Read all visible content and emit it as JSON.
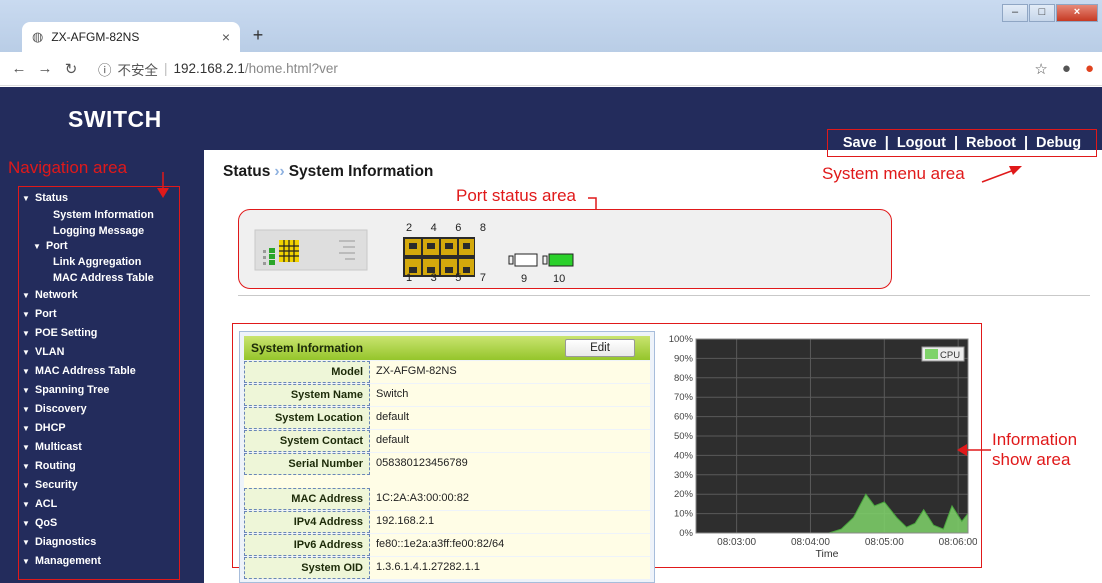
{
  "browser": {
    "tab_title": "ZX-AFGM-82NS",
    "new_tab": "+",
    "url_security": "不安全",
    "url_host": "192.168.2.1",
    "url_path": "/home.html?ver"
  },
  "header": {
    "logo": "SWITCH",
    "menu": [
      "Save",
      "Logout",
      "Reboot",
      "Debug"
    ],
    "menu_sep": "|"
  },
  "sidebar": {
    "items": [
      {
        "label": "Status",
        "expanded": true
      },
      {
        "label": "System Information",
        "level": 2,
        "active": true
      },
      {
        "label": "Logging Message",
        "level": 2
      },
      {
        "label": "Port",
        "level": 2,
        "expanded": true
      },
      {
        "label": "Link Aggregation",
        "level": 2
      },
      {
        "label": "MAC Address Table",
        "level": 2
      },
      {
        "label": "Network"
      },
      {
        "label": "Port"
      },
      {
        "label": "POE Setting"
      },
      {
        "label": "VLAN"
      },
      {
        "label": "MAC Address Table"
      },
      {
        "label": "Spanning Tree"
      },
      {
        "label": "Discovery"
      },
      {
        "label": "DHCP"
      },
      {
        "label": "Multicast"
      },
      {
        "label": "Routing"
      },
      {
        "label": "Security"
      },
      {
        "label": "ACL"
      },
      {
        "label": "QoS"
      },
      {
        "label": "Diagnostics"
      },
      {
        "label": "Management"
      }
    ]
  },
  "breadcrumb": {
    "parent": "Status",
    "sep": "››",
    "current": "System Information"
  },
  "annotations": {
    "navigation": "Navigation area",
    "port_status": "Port status area",
    "system_menu": "System menu area",
    "info_show": "Information show area"
  },
  "ports": {
    "top_numbers": [
      "2",
      "4",
      "6",
      "8"
    ],
    "bottom_numbers": [
      "1",
      "3",
      "5",
      "7"
    ],
    "sfp": [
      "9",
      "10"
    ],
    "sfp_active": [
      false,
      true
    ]
  },
  "sysinfo": {
    "title": "System Information",
    "edit_label": "Edit",
    "rows": [
      {
        "key": "Model",
        "value": "ZX-AFGM-82NS"
      },
      {
        "key": "System Name",
        "value": "Switch"
      },
      {
        "key": "System Location",
        "value": "default"
      },
      {
        "key": "System Contact",
        "value": "default"
      },
      {
        "key": "Serial Number",
        "value": "058380123456789"
      },
      {
        "key": "MAC Address",
        "value": "1C:2A:A3:00:00:82"
      },
      {
        "key": "IPv4 Address",
        "value": "192.168.2.1"
      },
      {
        "key": "IPv6 Address",
        "value": "fe80::1e2a:a3ff:fe00:82/64"
      },
      {
        "key": "System OID",
        "value": "1.3.6.1.4.1.27282.1.1"
      }
    ]
  },
  "chart_data": {
    "type": "area",
    "xlabel": "Time",
    "ylabel": "",
    "ylim": [
      0,
      100
    ],
    "yticks": [
      "0%",
      "10%",
      "20%",
      "30%",
      "40%",
      "50%",
      "60%",
      "70%",
      "80%",
      "90%",
      "100%"
    ],
    "xticks": [
      "08:03:00",
      "08:04:00",
      "08:05:00",
      "08:06:00"
    ],
    "grid": true,
    "legend": "top-right",
    "background": "#2e2e2e",
    "series": [
      {
        "name": "CPU",
        "color": "#7fd36a",
        "x": [
          "08:02:27",
          "08:04:15",
          "08:04:25",
          "08:04:35",
          "08:04:45",
          "08:04:52",
          "08:05:00",
          "08:05:10",
          "08:05:18",
          "08:05:25",
          "08:05:32",
          "08:05:40",
          "08:05:48",
          "08:05:55",
          "08:06:03",
          "08:06:08"
        ],
        "values": [
          0,
          0,
          2,
          8,
          20,
          14,
          16,
          8,
          3,
          5,
          12,
          4,
          2,
          14,
          6,
          10
        ]
      }
    ]
  }
}
